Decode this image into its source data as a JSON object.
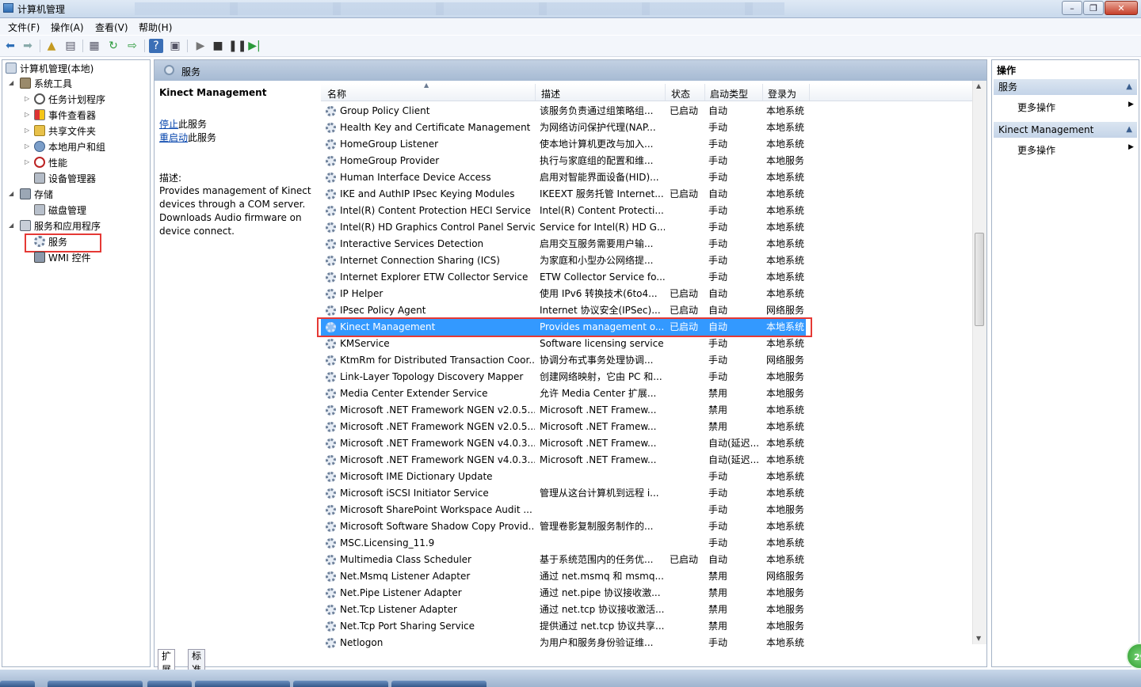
{
  "window": {
    "title": "计算机管理"
  },
  "menu": [
    "文件(F)",
    "操作(A)",
    "查看(V)",
    "帮助(H)"
  ],
  "tree": {
    "root": "计算机管理(本地)",
    "items": [
      {
        "label": "系统工具"
      },
      {
        "label": "任务计划程序"
      },
      {
        "label": "事件查看器"
      },
      {
        "label": "共享文件夹"
      },
      {
        "label": "本地用户和组"
      },
      {
        "label": "性能"
      },
      {
        "label": "设备管理器"
      },
      {
        "label": "存储"
      },
      {
        "label": "磁盘管理"
      },
      {
        "label": "服务和应用程序"
      },
      {
        "label": "服务"
      },
      {
        "label": "WMI 控件"
      }
    ]
  },
  "center": {
    "header": "服务",
    "detail": {
      "name": "Kinect Management",
      "stop_link": "停止",
      "stop_suffix": "此服务",
      "restart_link": "重启动",
      "restart_suffix": "此服务",
      "desc_label": "描述:",
      "desc_text": "Provides management of Kinect devices through a COM server. Downloads Audio firmware on device connect."
    },
    "columns": [
      "名称",
      "描述",
      "状态",
      "启动类型",
      "登录为"
    ],
    "rows": [
      [
        "Group Policy Client",
        "该服务负责通过组策略组...",
        "已启动",
        "自动",
        "本地系统"
      ],
      [
        "Health Key and Certificate Management",
        "为网络访问保护代理(NAP...",
        "",
        "手动",
        "本地系统"
      ],
      [
        "HomeGroup Listener",
        "使本地计算机更改与加入...",
        "",
        "手动",
        "本地系统"
      ],
      [
        "HomeGroup Provider",
        "执行与家庭组的配置和维...",
        "",
        "手动",
        "本地服务"
      ],
      [
        "Human Interface Device Access",
        "启用对智能界面设备(HID)...",
        "",
        "手动",
        "本地系统"
      ],
      [
        "IKE and AuthIP IPsec Keying Modules",
        "IKEEXT 服务托管 Internet...",
        "已启动",
        "自动",
        "本地系统"
      ],
      [
        "Intel(R) Content Protection HECI Service",
        "Intel(R) Content Protecti...",
        "",
        "手动",
        "本地系统"
      ],
      [
        "Intel(R) HD Graphics Control Panel Service",
        "Service for Intel(R) HD G...",
        "",
        "手动",
        "本地系统"
      ],
      [
        "Interactive Services Detection",
        "启用交互服务需要用户输...",
        "",
        "手动",
        "本地系统"
      ],
      [
        "Internet Connection Sharing (ICS)",
        "为家庭和小型办公网络提...",
        "",
        "手动",
        "本地系统"
      ],
      [
        "Internet Explorer ETW Collector Service",
        "ETW Collector Service fo...",
        "",
        "手动",
        "本地系统"
      ],
      [
        "IP Helper",
        "使用 IPv6 转换技术(6to4...",
        "已启动",
        "自动",
        "本地系统"
      ],
      [
        "IPsec Policy Agent",
        "Internet 协议安全(IPSec)...",
        "已启动",
        "自动",
        "网络服务"
      ],
      [
        "Kinect Management",
        "Provides management o...",
        "已启动",
        "自动",
        "本地系统"
      ],
      [
        "KMService",
        "Software licensing service",
        "",
        "手动",
        "本地系统"
      ],
      [
        "KtmRm for Distributed Transaction Coor...",
        "协调分布式事务处理协调...",
        "",
        "手动",
        "网络服务"
      ],
      [
        "Link-Layer Topology Discovery Mapper",
        "创建网络映射，它由 PC 和...",
        "",
        "手动",
        "本地服务"
      ],
      [
        "Media Center Extender Service",
        "允许 Media Center 扩展...",
        "",
        "禁用",
        "本地服务"
      ],
      [
        "Microsoft .NET Framework NGEN v2.0.5...",
        "Microsoft .NET Framew...",
        "",
        "禁用",
        "本地系统"
      ],
      [
        "Microsoft .NET Framework NGEN v2.0.5...",
        "Microsoft .NET Framew...",
        "",
        "禁用",
        "本地系统"
      ],
      [
        "Microsoft .NET Framework NGEN v4.0.3...",
        "Microsoft .NET Framew...",
        "",
        "自动(延迟...",
        "本地系统"
      ],
      [
        "Microsoft .NET Framework NGEN v4.0.3...",
        "Microsoft .NET Framew...",
        "",
        "自动(延迟...",
        "本地系统"
      ],
      [
        "Microsoft IME Dictionary Update",
        "",
        "",
        "手动",
        "本地系统"
      ],
      [
        "Microsoft iSCSI Initiator Service",
        "管理从这台计算机到远程 i...",
        "",
        "手动",
        "本地系统"
      ],
      [
        "Microsoft SharePoint Workspace Audit ...",
        "",
        "",
        "手动",
        "本地服务"
      ],
      [
        "Microsoft Software Shadow Copy Provid...",
        "管理卷影复制服务制作的...",
        "",
        "手动",
        "本地系统"
      ],
      [
        "MSC.Licensing_11.9",
        "",
        "",
        "手动",
        "本地系统"
      ],
      [
        "Multimedia Class Scheduler",
        "基于系统范围内的任务优...",
        "已启动",
        "自动",
        "本地系统"
      ],
      [
        "Net.Msmq Listener Adapter",
        "通过 net.msmq 和 msmq...",
        "",
        "禁用",
        "网络服务"
      ],
      [
        "Net.Pipe Listener Adapter",
        "通过 net.pipe 协议接收激...",
        "",
        "禁用",
        "本地服务"
      ],
      [
        "Net.Tcp Listener Adapter",
        "通过 net.tcp 协议接收激活...",
        "",
        "禁用",
        "本地服务"
      ],
      [
        "Net.Tcp Port Sharing Service",
        "提供通过 net.tcp 协议共享...",
        "",
        "禁用",
        "本地服务"
      ],
      [
        "Netlogon",
        "为用户和服务身份验证维...",
        "",
        "手动",
        "本地系统"
      ]
    ],
    "selected_index": 13,
    "tabs": [
      "扩展",
      "标准"
    ]
  },
  "actions": {
    "title": "操作",
    "sections": [
      {
        "header": "服务",
        "item": "更多操作"
      },
      {
        "header": "Kinect Management",
        "item": "更多操作"
      }
    ]
  },
  "tray_badge": "29"
}
